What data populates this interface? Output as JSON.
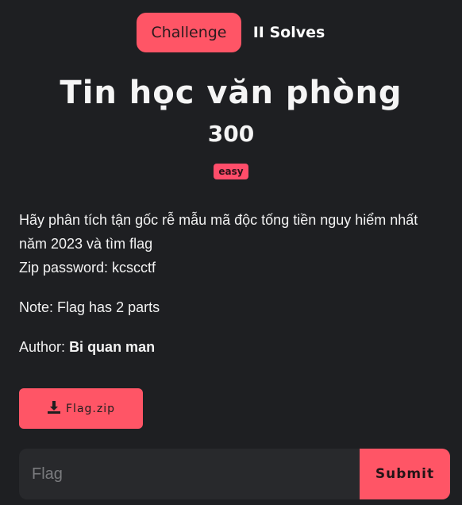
{
  "tabs": {
    "challenge": "Challenge",
    "solves": "II Solves"
  },
  "challenge": {
    "title": "Tin học văn phòng",
    "points": "300",
    "difficulty": "easy"
  },
  "description": {
    "line1": "Hãy phân tích tận gốc rễ mẫu mã độc tống tiền nguy hiểm nhất năm 2023 và tìm flag",
    "line2": "Zip password: kcscctf",
    "note": "Note: Flag has 2 parts",
    "author_label": "Author:",
    "author_name": "Bi quan man"
  },
  "download": {
    "icon": "download-icon",
    "label": "Flag.zip"
  },
  "flag_form": {
    "placeholder": "Flag",
    "value": "",
    "submit_label": "Submit"
  },
  "colors": {
    "accent": "#ff5566",
    "background": "#1e1f22",
    "input_bg": "#28292c"
  }
}
